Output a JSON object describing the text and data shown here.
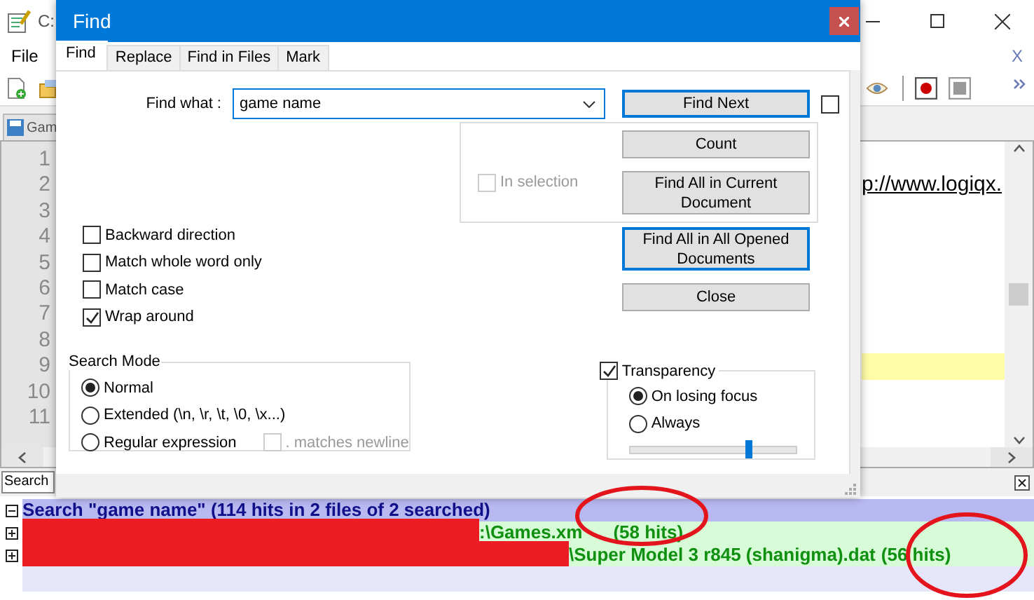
{
  "app": {
    "title": "C:",
    "menu": [
      "File"
    ],
    "menu_close": "X",
    "tab": "Gam",
    "lines": [
      {
        "number": "1",
        "highlighted": false
      },
      {
        "number": "2",
        "text": "p://www.logiqx.",
        "highlighted": false
      },
      {
        "number": "3",
        "highlighted": false
      },
      {
        "number": "4",
        "highlighted": false
      },
      {
        "number": "5",
        "highlighted": false
      },
      {
        "number": "6",
        "highlighted": false
      },
      {
        "number": "7",
        "highlighted": false
      },
      {
        "number": "8",
        "highlighted": false
      },
      {
        "number": "9",
        "highlighted": true
      },
      {
        "number": "10",
        "highlighted": false
      },
      {
        "number": "11",
        "highlighted": false
      }
    ]
  },
  "dialog": {
    "title": "Find",
    "tabs": [
      {
        "label": "Find",
        "selected": true
      },
      {
        "label": "Replace",
        "selected": false
      },
      {
        "label": "Find in Files",
        "selected": false
      },
      {
        "label": "Mark",
        "selected": false
      }
    ],
    "find_what": {
      "label": "Find what :",
      "value": "game name"
    },
    "side_box": {
      "checked": false
    },
    "in_selection": {
      "label": "In selection",
      "checked": false,
      "disabled": true
    },
    "options": [
      {
        "label": "Backward direction",
        "checked": false
      },
      {
        "label": "Match whole word only",
        "checked": false
      },
      {
        "label": "Match case",
        "checked": false
      },
      {
        "label": "Wrap around",
        "checked": true
      }
    ],
    "buttons": [
      {
        "label": "Find Next",
        "highlighted": true
      },
      {
        "label": "Count",
        "highlighted": false
      },
      {
        "label": "Find All in Current Document",
        "highlighted": false
      },
      {
        "label": "Find All in All Opened Documents",
        "highlighted": true
      },
      {
        "label": "Close",
        "highlighted": false
      }
    ],
    "search_mode": {
      "title": "Search Mode",
      "modes": [
        {
          "label": "Normal",
          "selected": true
        },
        {
          "label": "Extended (\\n, \\r, \\t, \\0, \\x...)",
          "selected": false
        },
        {
          "label": "Regular expression",
          "selected": false
        }
      ],
      "dot_newline": {
        "label": ". matches newline",
        "checked": false,
        "disabled": true
      }
    },
    "transparency": {
      "label": "Transparency",
      "checked": true,
      "modes": [
        {
          "label": "On losing focus",
          "selected": true
        },
        {
          "label": "Always",
          "selected": false
        }
      ],
      "level": 0.71
    }
  },
  "results": {
    "search_field": "Search",
    "header": "Search \"game name\" (114 hits in 2 files of 2 searched)",
    "files": [
      {
        "text": ":\\Games.xm",
        "hits": "(58 hits)",
        "redacted": true
      },
      {
        "text": "\\Super Model 3 r845 (shanigma).dat",
        "hits": "(56 hits)",
        "redacted": true
      }
    ]
  }
}
